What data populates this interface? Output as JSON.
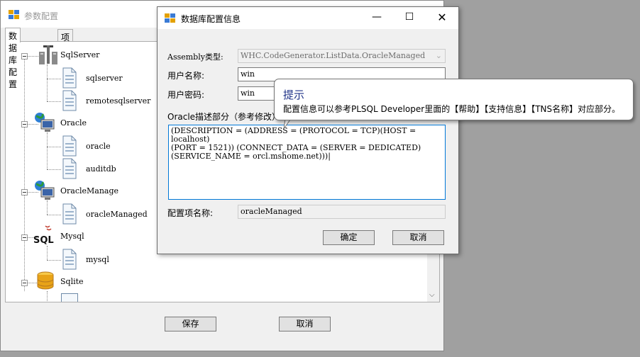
{
  "main_window": {
    "title": "参数配置",
    "tabs": [
      "数据库配置",
      "项目配置"
    ],
    "save_label": "保存",
    "cancel_label": "取消"
  },
  "tree": {
    "groups": [
      {
        "label": "SqlServer",
        "icon": "database-tools-icon",
        "children": [
          "sqlserver",
          "remotesqlserver"
        ]
      },
      {
        "label": "Oracle",
        "icon": "network-computer-icon",
        "children": [
          "oracle",
          "auditdb"
        ]
      },
      {
        "label": "OracleManage",
        "icon": "network-computer-icon",
        "children": [
          "oracleManaged"
        ]
      },
      {
        "label": "Mysql",
        "icon": "sql-icon",
        "children": [
          "mysql"
        ]
      },
      {
        "label": "Sqlite",
        "icon": "database-cylinder-icon",
        "children": []
      }
    ]
  },
  "dialog": {
    "title": "数据库配置信息",
    "assembly_label": "Assembly类型:",
    "assembly_value": "WHC.CodeGenerator.ListData.OracleManaged",
    "username_label": "用户名称:",
    "username_value": "win",
    "password_label": "用户密码:",
    "password_value": "win",
    "oracle_label": "Oracle描述部分（参考修改）:",
    "oracle_value": "(DESCRIPTION = (ADDRESS = (PROTOCOL = TCP)(HOST = localhost)\n(PORT = 1521)) (CONNECT_DATA = (SERVER = DEDICATED)\n(SERVICE_NAME = orcl.mshome.net)))|",
    "config_name_label": "配置项名称:",
    "config_name_value": "oracleManaged",
    "ok_label": "确定",
    "cancel_label": "取消"
  },
  "tooltip": {
    "title": "提示",
    "message": "配置信息可以参考PLSQL Developer里面的【帮助】【支持信息】【TNS名称】对应部分。"
  },
  "colors": {
    "accent": "#0078d7",
    "tooltip_title": "#1e3287",
    "desktop": "#a0a0a0"
  }
}
